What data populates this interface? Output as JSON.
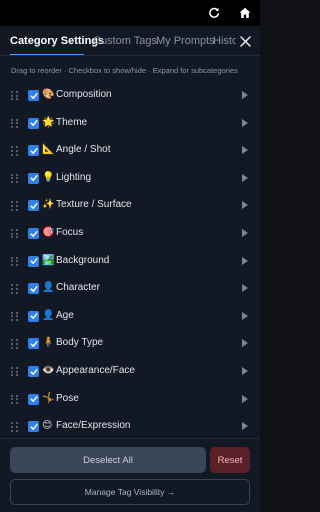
{
  "topbar": {
    "refresh_icon": "refresh-icon",
    "home_icon": "home-icon"
  },
  "tabs": [
    {
      "label": "Category Settings",
      "active": true
    },
    {
      "label": "Custom Tags",
      "active": false
    },
    {
      "label": "My Prompts",
      "active": false
    },
    {
      "label": "History",
      "active": false
    }
  ],
  "close_icon": "close-icon",
  "hint": "Drag to reorder · Checkbox to show/hide · Expand for subcategories",
  "categories": [
    {
      "emoji": "🎨",
      "label": "Composition",
      "checked": true
    },
    {
      "emoji": "🌟",
      "label": "Theme",
      "checked": true
    },
    {
      "emoji": "📐",
      "label": "Angle / Shot",
      "checked": true
    },
    {
      "emoji": "💡",
      "label": "Lighting",
      "checked": true
    },
    {
      "emoji": "✨",
      "label": "Texture / Surface",
      "checked": true
    },
    {
      "emoji": "🎯",
      "label": "Focus",
      "checked": true
    },
    {
      "emoji": "🏞️",
      "label": "Background",
      "checked": true
    },
    {
      "emoji": "👤",
      "label": "Character",
      "checked": true
    },
    {
      "emoji": "👤",
      "label": "Age",
      "checked": true
    },
    {
      "emoji": "🧍",
      "label": "Body Type",
      "checked": true
    },
    {
      "emoji": "👁️",
      "label": "Appearance/Face",
      "checked": true
    },
    {
      "emoji": "🤸",
      "label": "Pose",
      "checked": true
    },
    {
      "emoji": "😊",
      "label": "Face/Expression",
      "checked": true
    }
  ],
  "footer": {
    "deselect_label": "Deselect All",
    "reset_label": "Reset",
    "manage_label": "Manage Tag Visibility →"
  },
  "colors": {
    "accent": "#4a9eff",
    "checkbox": "#2f80ed",
    "reset_bg": "#5a1f27"
  }
}
